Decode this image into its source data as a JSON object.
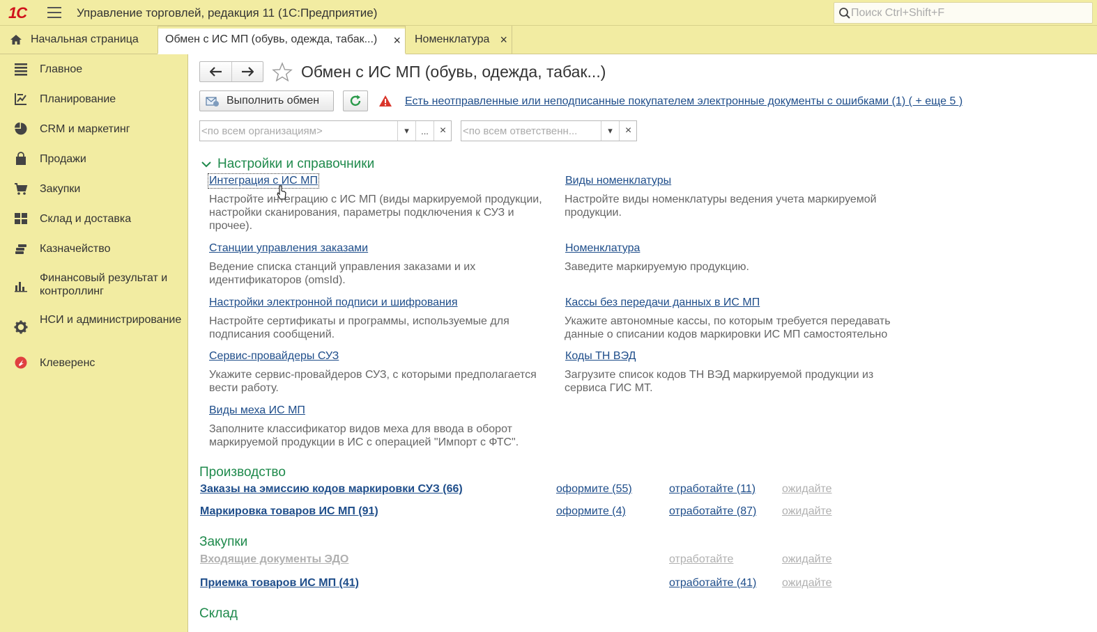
{
  "app": {
    "logo": "1С",
    "title": "Управление торговлей, редакция 11  (1С:Предприятие)",
    "search_placeholder": "Поиск Ctrl+Shift+F"
  },
  "tabs": [
    {
      "label": "Начальная страница"
    },
    {
      "label": "Обмен с ИС МП (обувь, одежда, табак...)",
      "close": "×"
    },
    {
      "label": "Номенклатура",
      "close": "×"
    }
  ],
  "sidebar": {
    "items": [
      {
        "label": "Главное",
        "icon": "menu-lines-icon"
      },
      {
        "label": "Планирование",
        "icon": "planning-icon"
      },
      {
        "label": "CRM и маркетинг",
        "icon": "pie-icon"
      },
      {
        "label": "Продажи",
        "icon": "bag-icon"
      },
      {
        "label": "Закупки",
        "icon": "cart-icon"
      },
      {
        "label": "Склад и доставка",
        "icon": "warehouse-icon"
      },
      {
        "label": "Казначейство",
        "icon": "coins-icon"
      },
      {
        "label": "Финансовый результат и контроллинг",
        "icon": "bar-chart-icon"
      },
      {
        "label": "НСИ и администрирование",
        "icon": "gear-icon"
      },
      {
        "label": "Клеверенс",
        "icon": "cleverence-icon"
      }
    ]
  },
  "page": {
    "title": "Обмен с ИС МП (обувь, одежда, табак...)",
    "exec_button": "Выполнить обмен",
    "warning_link": "Есть неотправленные или неподписанные покупателем электронные документы с ошибками (1) ( + еще 5 )",
    "org_placeholder": "<по всем организациям>",
    "resp_placeholder": "<по всем ответственн...",
    "more_btn": "...",
    "dropdown_glyph": "▾",
    "clear_glyph": "×"
  },
  "settings": {
    "header": "Настройки и справочники",
    "left": [
      {
        "title": "Интеграция с ИС МП",
        "desc": "Настройте интеграцию с ИС МП (виды маркируемой продукции, настройки сканирования, параметры подключения к СУЗ и прочее)."
      },
      {
        "title": "Станции управления заказами",
        "desc": "Ведение списка станций управления заказами и их идентификаторов (omsId)."
      },
      {
        "title": "Настройки электронной подписи и шифрования",
        "desc": "Настройте сертификаты и программы, используемые для подписания сообщений."
      },
      {
        "title": "Сервис-провайдеры СУЗ",
        "desc": "Укажите сервис-провайдеров СУЗ, с которыми предполагается вести работу."
      },
      {
        "title": "Виды меха ИС МП",
        "desc": "Заполните классификатор видов меха для  ввода в оборот маркируемой продукции в ИС с операцией \"Импорт с ФТС\"."
      }
    ],
    "right": [
      {
        "title": "Виды номенклатуры",
        "desc": "Настройте виды номенклатуры ведения учета маркируемой продукции."
      },
      {
        "title": "Номенклатура",
        "desc": "Заведите маркируемую продукцию."
      },
      {
        "title": "Кассы без передачи данных в ИС МП",
        "desc": "Укажите автономные кассы, по которым требуется передавать данные о списании кодов маркировки ИС МП самостоятельно"
      },
      {
        "title": "Коды ТН ВЭД",
        "desc": "Загрузите список кодов ТН ВЭД маркируемой продукции из сервиса ГИС МТ."
      }
    ]
  },
  "production": {
    "header": "Производство",
    "rows": [
      {
        "title": "Заказы на эмиссию кодов маркировки СУЗ (66)",
        "a1": "оформите (55)",
        "a2": "отработайте (11)",
        "a3": "ожидайте"
      },
      {
        "title": "Маркировка товаров ИС МП (91)",
        "a1": "оформите (4)",
        "a2": "отработайте (87)",
        "a3": "ожидайте"
      }
    ]
  },
  "purchases": {
    "header": "Закупки",
    "rows": [
      {
        "title": "Входящие документы ЭДО",
        "a2": "отработайте",
        "a3": "ожидайте"
      },
      {
        "title": "Приемка товаров ИС МП (41)",
        "a2": "отработайте (41)",
        "a3": "ожидайте"
      }
    ]
  },
  "warehouse": {
    "header": "Склад"
  }
}
